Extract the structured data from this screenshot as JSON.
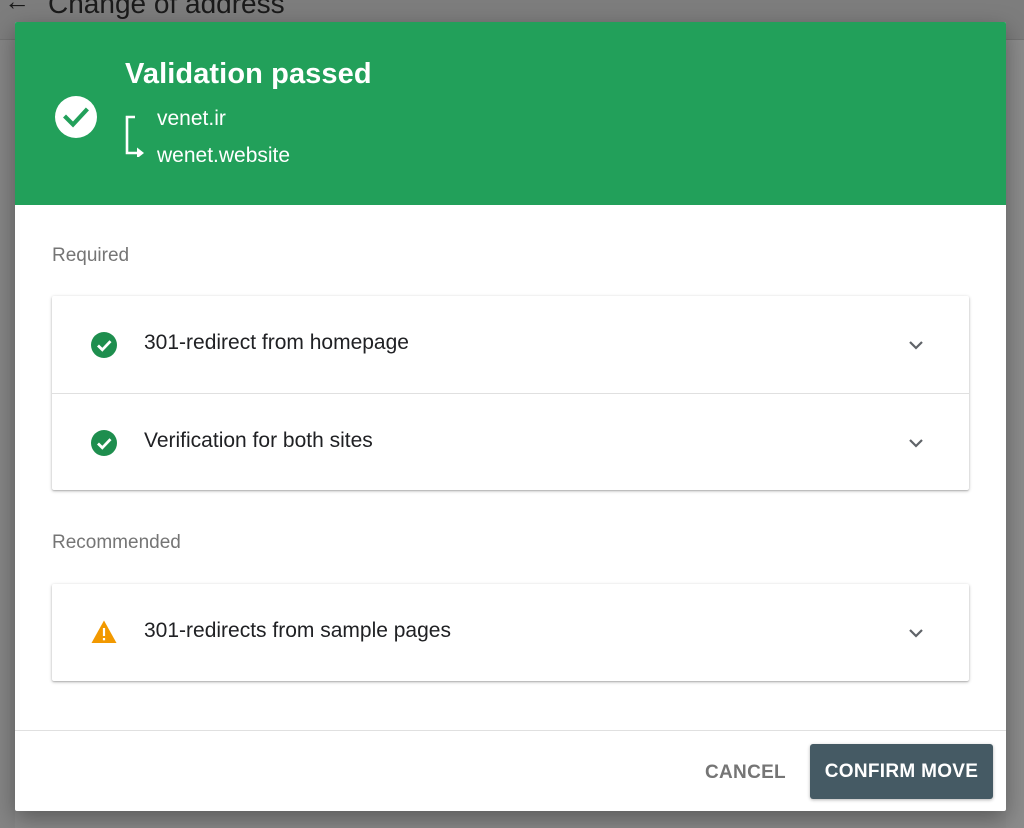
{
  "background_page": {
    "title": "Change of address"
  },
  "dialog": {
    "header": {
      "status_title": "Validation passed",
      "from_site": "venet.ir",
      "to_site": "wenet.website",
      "bg_color": "#22a05a"
    },
    "required": {
      "label": "Required",
      "items": [
        {
          "label": "301-redirect from homepage",
          "status": "passed",
          "icon": "check-circle-icon"
        },
        {
          "label": "Verification for both sites",
          "status": "passed",
          "icon": "check-circle-icon"
        }
      ]
    },
    "recommended": {
      "label": "Recommended",
      "items": [
        {
          "label": "301-redirects from sample pages",
          "status": "warning",
          "icon": "warning-icon"
        }
      ]
    },
    "actions": {
      "cancel_label": "CANCEL",
      "confirm_label": "CONFIRM MOVE"
    },
    "colors": {
      "success": "#1e8e4e",
      "warning": "#f29900",
      "confirm_button": "#455a64"
    }
  }
}
